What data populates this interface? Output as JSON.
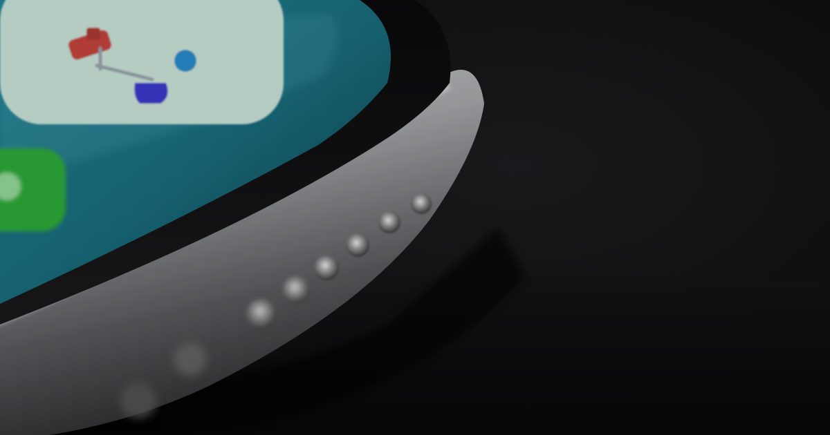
{
  "scene": {
    "description_free": true,
    "colors": {
      "background": "#141416",
      "surface": "#0c0c0d",
      "screen_teal": "#1f7d8a",
      "screen_deep": "#0f4f5e",
      "app_icon_mint": "#cfe9df",
      "app_icon_green": "#2fae3a",
      "accent_red": "#c8443e",
      "accent_blue": "#2b8fd0",
      "accent_indigo": "#3d3ad0",
      "frame_silver": "#bfc0c2",
      "frame_dark": "#3a3a3c"
    },
    "icons": [
      "app-icon",
      "app-icon-green",
      "speaker-hole"
    ],
    "speaker_holes": 9
  }
}
